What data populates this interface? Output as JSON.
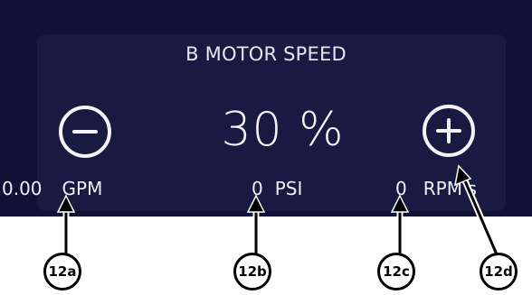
{
  "widget": {
    "title": "B MOTOR SPEED",
    "speed_value": "30 %",
    "decrease_button_icon": "minus-circle-icon",
    "increase_button_icon": "plus-circle-icon"
  },
  "readouts": {
    "flow": {
      "value": "0.00",
      "unit": "GPM"
    },
    "pressure": {
      "value": "0",
      "unit": "PSI"
    },
    "rpm": {
      "value": "0",
      "unit": "RPM's"
    }
  },
  "callouts": {
    "a": "12a",
    "b": "12b",
    "c": "12c",
    "d": "12d"
  },
  "colors": {
    "panel_background": "#0f1136",
    "card_background": "#181a42",
    "foreground": "#f4f4f8"
  }
}
